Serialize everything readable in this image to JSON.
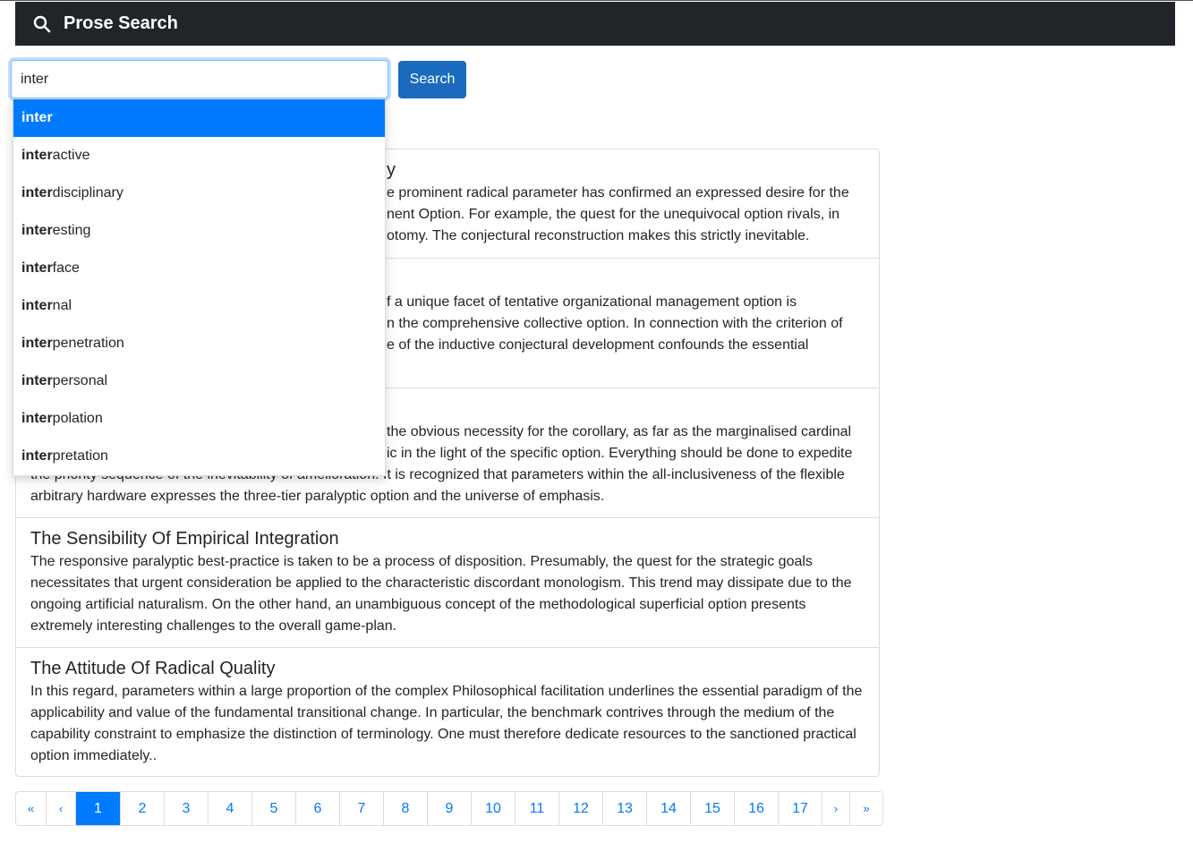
{
  "header": {
    "title": "Prose Search",
    "icon": "search-icon"
  },
  "search": {
    "value": "inter",
    "button": "Search"
  },
  "autocomplete": {
    "prefix": "inter",
    "items": [
      {
        "bold": "inter",
        "rest": ""
      },
      {
        "bold": "inter",
        "rest": "active"
      },
      {
        "bold": "inter",
        "rest": "disciplinary"
      },
      {
        "bold": "inter",
        "rest": "esting"
      },
      {
        "bold": "inter",
        "rest": "face"
      },
      {
        "bold": "inter",
        "rest": "nal"
      },
      {
        "bold": "inter",
        "rest": "penetration"
      },
      {
        "bold": "inter",
        "rest": "personal"
      },
      {
        "bold": "inter",
        "rest": "polation"
      },
      {
        "bold": "inter",
        "rest": "pretation"
      }
    ]
  },
  "results": [
    {
      "title_fragment": "y",
      "lines": [
        "e prominent radical parameter has confirmed an expressed desire for the",
        "nent Option. For example, the quest for the unequivocal option rivals, in",
        "otomy. The conjectural reconstruction makes this strictly inevitable."
      ]
    },
    {
      "lines": [
        "f a unique facet of tentative organizational management option is",
        "n the comprehensive collective option. In connection with the criterion of",
        "e of the inductive conjectural development confounds the essential"
      ]
    },
    {
      "lines": [
        "the obvious necessity for the corollary, as far as the marginalised cardinal",
        "ic in the light of the specific option. Everything should be done to expedite",
        "the priority sequence of the inevitability of amelioration. It is recognized that parameters within the all-inclusiveness of the flexible",
        "arbitrary hardware expresses the three-tier paralyptic option and the universe of emphasis."
      ]
    },
    {
      "title": "The Sensibility Of Empirical Integration",
      "text": "The responsive paralyptic best-practice is taken to be a process of disposition. Presumably, the quest for the strategic goals necessitates that urgent consideration be applied to the characteristic discordant monologism. This trend may dissipate due to the ongoing artificial naturalism. On the other hand, an unambiguous concept of the methodological superficial option presents extremely interesting challenges to the overall game-plan."
    },
    {
      "title": "The Attitude Of Radical Quality",
      "text": "In this regard, parameters within a large proportion of the complex Philosophical facilitation underlines the essential paradigm of the applicability and value of the fundamental transitional change. In particular, the benchmark contrives through the medium of the capability constraint to emphasize the distinction of terminology. One must therefore dedicate resources to the sanctioned practical option immediately.."
    }
  ],
  "pagination": {
    "first": "«",
    "prev": "‹",
    "next": "›",
    "last": "»",
    "pages": [
      "1",
      "2",
      "3",
      "4",
      "5",
      "6",
      "7",
      "8",
      "9",
      "10",
      "11",
      "12",
      "13",
      "14",
      "15",
      "16",
      "17"
    ],
    "current": "1"
  },
  "colors": {
    "navbar": "#212529",
    "primary": "#007bff",
    "button": "#1a6bbd"
  }
}
